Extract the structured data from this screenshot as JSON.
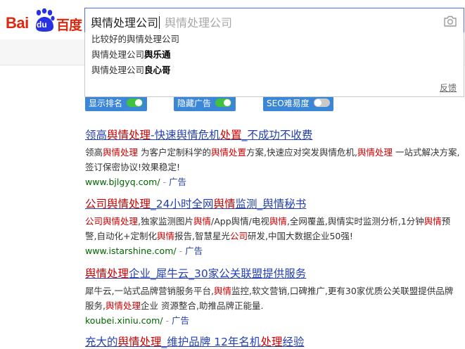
{
  "logo": {
    "latin_a": "Bai",
    "badge": "du",
    "chinese": "百度"
  },
  "search": {
    "value": "舆情处理公司",
    "placeholder": "舆情处理公司"
  },
  "suggestions": [
    {
      "plain": "比较好的舆情处理公司",
      "bold": ""
    },
    {
      "plain": "舆情处理公司",
      "bold": "舆乐通"
    },
    {
      "plain": "舆情处理公司",
      "bold": "良心哥"
    }
  ],
  "feedback_label": "反馈",
  "toggles": [
    {
      "label": "显示排名",
      "state": "on"
    },
    {
      "label": "隐藏广告",
      "state": "on"
    },
    {
      "label": "SEO难易度",
      "state": "off"
    }
  ],
  "results": [
    {
      "title": [
        {
          "t": "领高",
          "hl": false
        },
        {
          "t": "舆情处理",
          "hl": true
        },
        {
          "t": "-快速舆情危机",
          "hl": false
        },
        {
          "t": "处置",
          "hl": true
        },
        {
          "t": "_不成功不收费",
          "hl": false
        }
      ],
      "desc": [
        {
          "t": "领高",
          "hl": false
        },
        {
          "t": "舆情处理",
          "hl": true
        },
        {
          "t": " 为客户定制科学的",
          "hl": false
        },
        {
          "t": "舆情处置",
          "hl": true
        },
        {
          "t": "方案,快速应对突发舆情危机,",
          "hl": false
        },
        {
          "t": "舆情处理",
          "hl": true
        },
        {
          "t": " 一站式解决方案,签订保密协议!效果稳定!",
          "hl": false
        }
      ],
      "url": "www.bjlgyq.com/",
      "sep": " - ",
      "ad": "广告"
    },
    {
      "title": [
        {
          "t": "公司舆情处理",
          "hl": true
        },
        {
          "t": "_24小时全网",
          "hl": false
        },
        {
          "t": "舆情",
          "hl": true
        },
        {
          "t": "监测_舆情秘书",
          "hl": false
        }
      ],
      "desc": [
        {
          "t": "公司舆情处理",
          "hl": true
        },
        {
          "t": ",独家监测图片",
          "hl": false
        },
        {
          "t": "舆情",
          "hl": true
        },
        {
          "t": "/App舆情/电视",
          "hl": false
        },
        {
          "t": "舆情",
          "hl": true
        },
        {
          "t": ",全网覆盖,舆情实时监测分析,1分钟",
          "hl": false
        },
        {
          "t": "舆情",
          "hl": true
        },
        {
          "t": "预警,自动化+定制化",
          "hl": false
        },
        {
          "t": "舆情",
          "hl": true
        },
        {
          "t": "报告,智慧星光",
          "hl": false
        },
        {
          "t": "公司",
          "hl": true
        },
        {
          "t": "研发,中国大数据企业50强!",
          "hl": false
        }
      ],
      "url": "www.istarshine.com/",
      "sep": " - ",
      "ad": "广告"
    },
    {
      "title": [
        {
          "t": "舆情处理",
          "hl": true
        },
        {
          "t": "企业_犀牛云_30家公关联盟提供服务",
          "hl": false
        }
      ],
      "desc": [
        {
          "t": "犀牛云,一站式品牌营销服务平台,",
          "hl": false
        },
        {
          "t": "舆情",
          "hl": true
        },
        {
          "t": "监控,软文营销,口碑推广,更有30家优质公关联盟提供品牌服务,",
          "hl": false
        },
        {
          "t": "舆情处理",
          "hl": true
        },
        {
          "t": "企业 资源整合,助推品牌正能量.",
          "hl": false
        }
      ],
      "url": "koubei.xiniu.com/",
      "sep": " - ",
      "ad": "广告"
    },
    {
      "title": [
        {
          "t": "充大的",
          "hl": false
        },
        {
          "t": "舆情处理",
          "hl": true
        },
        {
          "t": "_维护品牌 12年名机",
          "hl": false
        },
        {
          "t": "处理",
          "hl": true
        },
        {
          "t": "经验",
          "hl": false
        }
      ],
      "desc": [],
      "url": "",
      "sep": "",
      "ad": ""
    }
  ],
  "colors": {
    "brand_red": "#de2910",
    "brand_blue": "#2932e1",
    "link_blue": "#2440b3",
    "highlight_red": "#cc0000",
    "url_green": "#006600",
    "toggle_blue": "#3b86d6",
    "switch_green": "#41c23e"
  },
  "icons": {
    "search_camera": "camera-icon",
    "logo_mark": "paw-icon"
  }
}
